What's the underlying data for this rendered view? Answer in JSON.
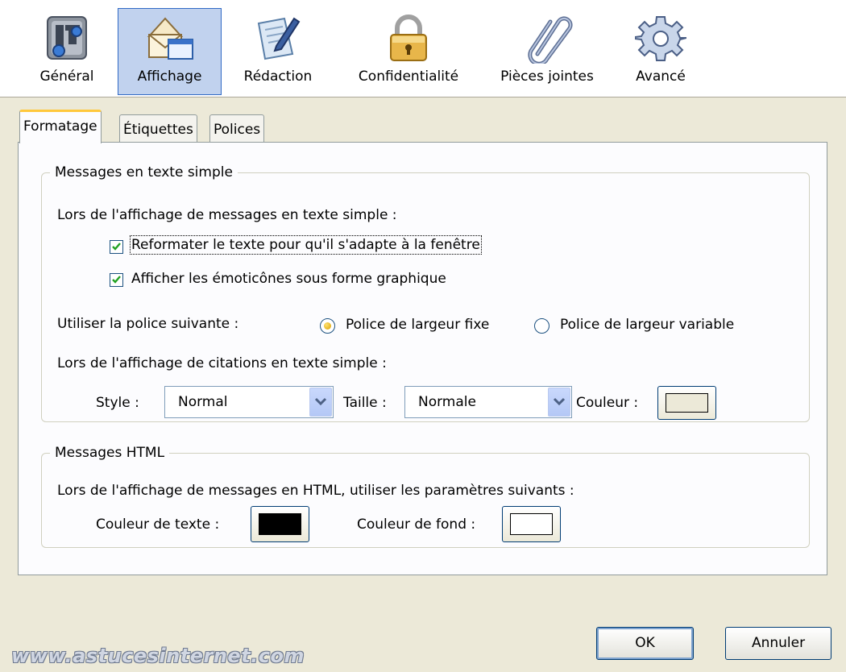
{
  "toolbar": {
    "items": [
      {
        "label": "Général",
        "icon": "general-icon",
        "selected": false
      },
      {
        "label": "Affichage",
        "icon": "display-icon",
        "selected": true
      },
      {
        "label": "Rédaction",
        "icon": "compose-icon",
        "selected": false
      },
      {
        "label": "Confidentialité",
        "icon": "padlock-icon",
        "selected": false
      },
      {
        "label": "Pièces jointes",
        "icon": "paperclip-icon",
        "selected": false
      },
      {
        "label": "Avancé",
        "icon": "gear-icon",
        "selected": false
      }
    ]
  },
  "tabs": [
    {
      "label": "Formatage",
      "active": true
    },
    {
      "label": "Étiquettes",
      "active": false
    },
    {
      "label": "Polices",
      "active": false
    }
  ],
  "plain": {
    "legend": "Messages en texte simple",
    "intro": "Lors de l'affichage de messages en texte simple :",
    "reformat_label": "Reformater le texte pour qu'il s'adapte à la fenêtre",
    "reformat_checked": true,
    "emoticons_label": "Afficher les émoticônes sous forme graphique",
    "emoticons_checked": true,
    "font_label": "Utiliser la police suivante :",
    "fixed_label": "Police de largeur fixe",
    "fixed_selected": true,
    "variable_label": "Police de largeur variable",
    "variable_selected": false,
    "quotes_intro": "Lors de l'affichage de citations en texte simple :",
    "style_label": "Style :",
    "style_value": "Normal",
    "size_label": "Taille :",
    "size_value": "Normale",
    "color_label": "Couleur :",
    "color_value": "#ece9d8"
  },
  "html": {
    "legend": "Messages HTML",
    "intro": "Lors de l'affichage de messages en HTML, utiliser les paramètres suivants :",
    "text_color_label": "Couleur de texte :",
    "text_color": "#000000",
    "bg_color_label": "Couleur de fond :",
    "bg_color": "#ffffff"
  },
  "buttons": {
    "ok": "OK",
    "cancel": "Annuler"
  },
  "watermark": "www.astucesinternet.com",
  "colors": {
    "dialog_bg": "#ece9d8",
    "selection": "#c1d2ee",
    "tab_accent": "#ffc83c"
  }
}
